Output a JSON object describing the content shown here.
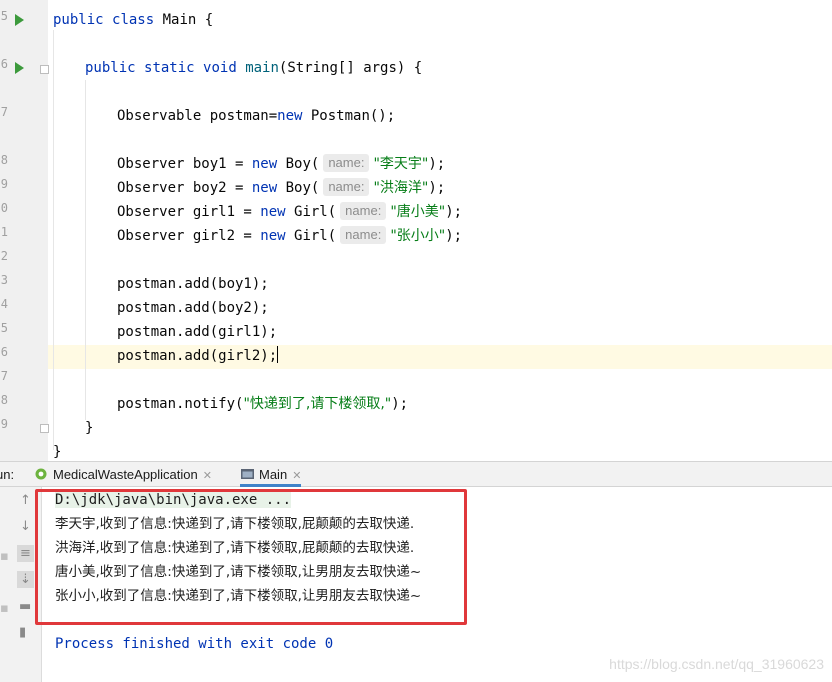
{
  "editor": {
    "line_numbers": [
      "5",
      "",
      "6",
      "",
      "7",
      "",
      "8",
      "9",
      "0",
      "1",
      "2",
      "",
      "3",
      "4",
      "5",
      "6",
      "7",
      "",
      "8",
      "9",
      ""
    ],
    "code": {
      "class_decl": {
        "kw1": "public",
        "kw2": "class",
        "name": "Main",
        "rest": " {"
      },
      "method_decl": {
        "kw1": "public",
        "kw2": "static",
        "kw3": "void",
        "name": "main",
        "rest": "(String[] args) {"
      },
      "postman_decl": {
        "pre": "Observable postman=",
        "kw": "new",
        "rest": " Postman();"
      },
      "boy1": {
        "pre": "Observer boy1 = ",
        "kw": "new",
        "cls": " Boy(",
        "hint": "name:",
        "str": "\"李天宇\"",
        "rest": ");"
      },
      "boy2": {
        "pre": "Observer boy2 = ",
        "kw": "new",
        "cls": " Boy(",
        "hint": "name:",
        "str": "\"洪海洋\"",
        "rest": ");"
      },
      "girl1": {
        "pre": "Observer girl1 = ",
        "kw": "new",
        "cls": " Girl(",
        "hint": "name:",
        "str": "\"唐小美\"",
        "rest": ");"
      },
      "girl2": {
        "pre": "Observer girl2 = ",
        "kw": "new",
        "cls": " Girl(",
        "hint": "name:",
        "str": "\"张小小\"",
        "rest": ");"
      },
      "add1": "postman.add(boy1);",
      "add2": "postman.add(boy2);",
      "add3": "postman.add(girl1);",
      "add4": "postman.add(girl2);",
      "notify": {
        "pre": "postman.notify(",
        "str": "\"快递到了,请下楼领取,\"",
        "rest": ");"
      },
      "close_method": "}",
      "close_class": "}"
    }
  },
  "run_panel": {
    "label": "un:",
    "tabs": [
      {
        "label": "MedicalWasteApplication",
        "icon": "spring-boot-icon",
        "close": "✕"
      },
      {
        "label": "Main",
        "icon": "console-icon",
        "close": "✕"
      }
    ]
  },
  "console": {
    "command": "D:\\jdk\\java\\bin\\java.exe ...",
    "lines": [
      "李天宇,收到了信息:快递到了,请下楼领取,屁颠颠的去取快递.",
      "洪海洋,收到了信息:快递到了,请下楼领取,屁颠颠的去取快递.",
      "唐小美,收到了信息:快递到了,请下楼领取,让男朋友去取快递~",
      "张小小,收到了信息:快递到了,请下楼领取,让男朋友去取快递~"
    ],
    "process": "Process finished with exit code 0"
  },
  "watermark": "https://blog.csdn.net/qq_31960623",
  "colors": {
    "keyword": "#0033b3",
    "string": "#067d17",
    "method": "#00627a",
    "highlight_box": "#e0383b",
    "run_arrow": "#3c9a3c"
  }
}
